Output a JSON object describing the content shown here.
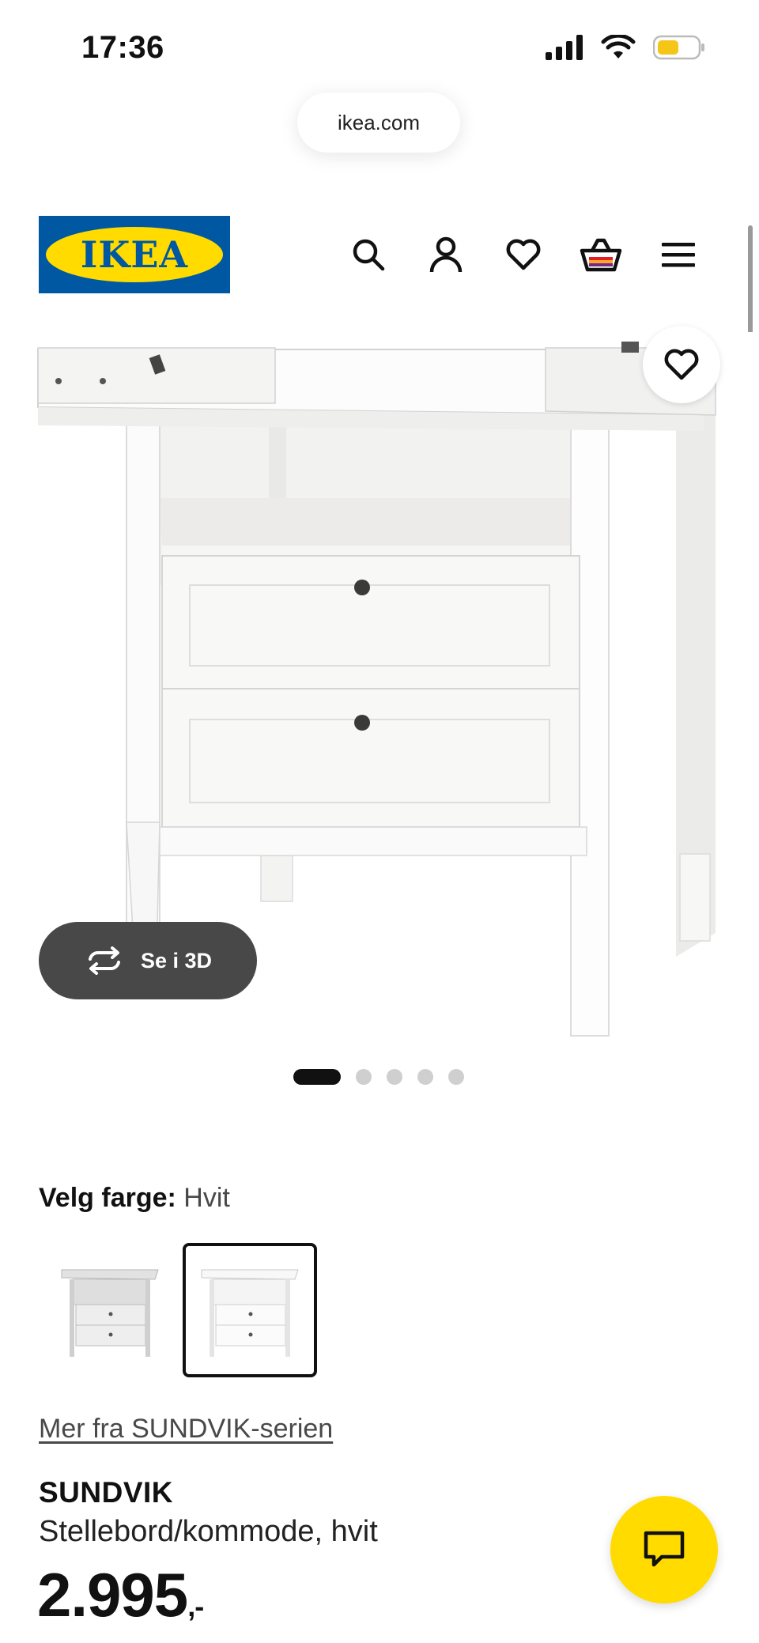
{
  "status_bar": {
    "time": "17:36"
  },
  "browser": {
    "url": "ikea.com"
  },
  "header": {
    "logo_text": "IKEA"
  },
  "hero": {
    "view_3d_label": "Se i 3D",
    "carousel_total": 5,
    "carousel_active": 1
  },
  "color": {
    "label": "Velg farge:",
    "value": "Hvit"
  },
  "series_link": "Mer fra SUNDVIK-serien",
  "product": {
    "name": "SUNDVIK",
    "description": "Stellebord/kommode, hvit",
    "price": "2.995",
    "price_suffix": ",-"
  },
  "colors": {
    "ikea_blue": "#0058a3",
    "ikea_yellow": "#ffdb00",
    "dark": "#111111"
  }
}
